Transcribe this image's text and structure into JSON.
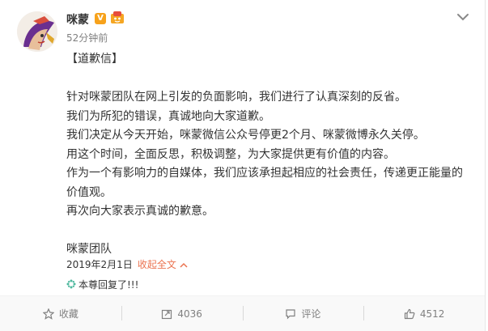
{
  "post": {
    "author": "咪蒙",
    "verified_badge": "V",
    "time_ago": "52分钟前",
    "paragraphs": [
      "【道歉信】",
      "",
      "针对咪蒙团队在网上引发的负面影响，我们进行了认真深刻的反省。",
      "我们为所犯的错误，真诚地向大家道歉。",
      "我们决定从今天开始，咪蒙微信公众号停更2个月、咪蒙微博永久关停。",
      "用这个时间，全面反思，积极调整，为大家提供更有价值的内容。",
      "作为一个有影响力的自媒体，我们应该承担起相应的社会责任，传递更正能量的",
      "价值观。",
      "再次向大家表示真诚的歉意。",
      "",
      "咪蒙团队"
    ],
    "date": "2019年2月1日",
    "collapse_label": "收起全文",
    "reply_note": "本尊回复了!!!"
  },
  "actions": {
    "favorite": "收藏",
    "repost_count": "4036",
    "comment": "评论",
    "like_count": "4512"
  },
  "colors": {
    "link": "#eb7350",
    "verified": "#f7a21b",
    "reply_icon": "#4fb89e"
  }
}
